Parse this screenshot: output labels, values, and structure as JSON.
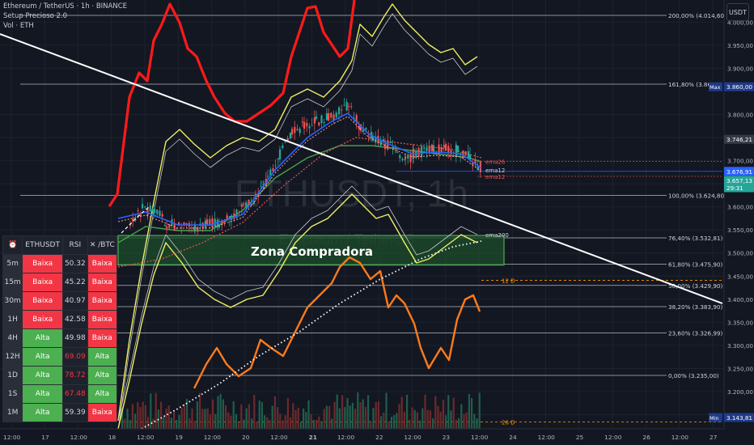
{
  "header": {
    "title": "Ethereum / TetherUS · 1h · BINANCE",
    "indicator1": "Setup Precioso 2.0",
    "indicator2": "Vol · ETH",
    "unit": "USDT"
  },
  "watermark": {
    "symbol": "ETHUSDT, 1h",
    "name": "Ethereum / TetherUS"
  },
  "zone_label": "Zona Compradora",
  "colors": {
    "background": "#131722",
    "grid": "#1e222d",
    "bull": "#26a69a",
    "bear": "#ef5350",
    "fib_line": "#d1d4dc",
    "trendline": "#ffffff",
    "zone_border": "#4caf50",
    "red_band": "#ff1a1a",
    "yellow_band": "#f0f060",
    "orange_line": "#ff7b1a",
    "ema_blue": "#2962ff"
  },
  "chart_data": {
    "type": "candlestick",
    "symbol": "ETHUSDT",
    "exchange": "BINANCE",
    "interval": "1h",
    "ylim": [
      3120,
      4020
    ],
    "x_ticks": [
      "12:00",
      "17",
      "12:00",
      "18",
      "12:00",
      "19",
      "12:00",
      "20",
      "12:00",
      "21",
      "12:00",
      "22",
      "12:00",
      "23",
      "12:00",
      "24",
      "12:00",
      "25",
      "12:00",
      "26",
      "12:00",
      "27"
    ],
    "price_ticks": [
      "4.000,00",
      "3.950,00",
      "3.900,00",
      "3.800,00",
      "3.750,00",
      "3.700,00",
      "3.650,00",
      "3.600,00",
      "3.550,00",
      "3.500,00",
      "3.450,00",
      "3.400,00",
      "3.350,00",
      "3.300,00",
      "3.250,00",
      "3.200,00",
      "3.150,00"
    ],
    "price_tick_values": [
      4000,
      3950,
      3900,
      3800,
      3750,
      3700,
      3650,
      3600,
      3550,
      3500,
      3450,
      3400,
      3350,
      3300,
      3250,
      3200,
      3150
    ],
    "fib_levels": [
      {
        "label": "200,00% (4.014,60)",
        "price": 4014.6
      },
      {
        "label": "161,80% (3.865,7",
        "price": 3865.7
      },
      {
        "label": "100,00% (3.624,80)",
        "price": 3624.8
      },
      {
        "label": "76,40% (3.532,81)",
        "price": 3532.81
      },
      {
        "label": "61,80% (3.475,90)",
        "price": 3475.9
      },
      {
        "label": "50,00% (3.429,90)",
        "price": 3429.9
      },
      {
        "label": "38,20% (3.383,90)",
        "price": 3383.9
      },
      {
        "label": "23,60% (3.326,99)",
        "price": 3326.99
      },
      {
        "label": "0,00% (3.235,00)",
        "price": 3235.0
      }
    ],
    "price_badges": [
      {
        "label": "Max",
        "value": "3.860,00",
        "price": 3860.0,
        "color": "#1e3a8a"
      },
      {
        "label": "",
        "value": "3.746,21",
        "price": 3746.21,
        "color": "#363a45"
      },
      {
        "label": "",
        "value": "3.676,91",
        "price": 3676.91,
        "color": "#2962ff"
      },
      {
        "label": "",
        "value": "3.657,13",
        "sub": "29:31",
        "price": 3657.13,
        "color": "#26a69a"
      },
      {
        "label": "Min",
        "value": "3.143,81",
        "price": 3143.81,
        "color": "#1e3a8a"
      }
    ],
    "line_labels": [
      {
        "text": "ema12",
        "price": 3680
      },
      {
        "text": "ema200",
        "price": 3540
      },
      {
        "text": "12 D",
        "price": 3441
      },
      {
        "text": "26 D",
        "price": 3134
      },
      {
        "text": "ema26",
        "price": 3698
      },
      {
        "text": "ema12",
        "price": 3666
      }
    ],
    "zone": {
      "label": "Zona Compradora",
      "top": 3538,
      "bottom": 3474
    },
    "rsi_table": {
      "headers": [
        "ETHUSDT",
        "RSI",
        "/BTC"
      ],
      "rows": [
        {
          "tf": "5m",
          "status": "Baixa",
          "rsi": "50.32",
          "btc": "Baixa",
          "hi": false
        },
        {
          "tf": "15m",
          "status": "Baixa",
          "rsi": "45.22",
          "btc": "Baixa",
          "hi": false
        },
        {
          "tf": "30m",
          "status": "Baixa",
          "rsi": "40.97",
          "btc": "Baixa",
          "hi": false
        },
        {
          "tf": "1H",
          "status": "Baixa",
          "rsi": "42.58",
          "btc": "Baixa",
          "hi": false
        },
        {
          "tf": "4H",
          "status": "Alta",
          "rsi": "49.98",
          "btc": "Baixa",
          "hi": false
        },
        {
          "tf": "12H",
          "status": "Alta",
          "rsi": "69.09",
          "btc": "Alta",
          "hi": true
        },
        {
          "tf": "1D",
          "status": "Alta",
          "rsi": "78.72",
          "btc": "Alta",
          "hi": true
        },
        {
          "tf": "1S",
          "status": "Alta",
          "rsi": "67.48",
          "btc": "Alta",
          "hi": true
        },
        {
          "tf": "1M",
          "status": "Alta",
          "rsi": "59.39",
          "btc": "Baixa",
          "hi": false
        }
      ]
    }
  }
}
